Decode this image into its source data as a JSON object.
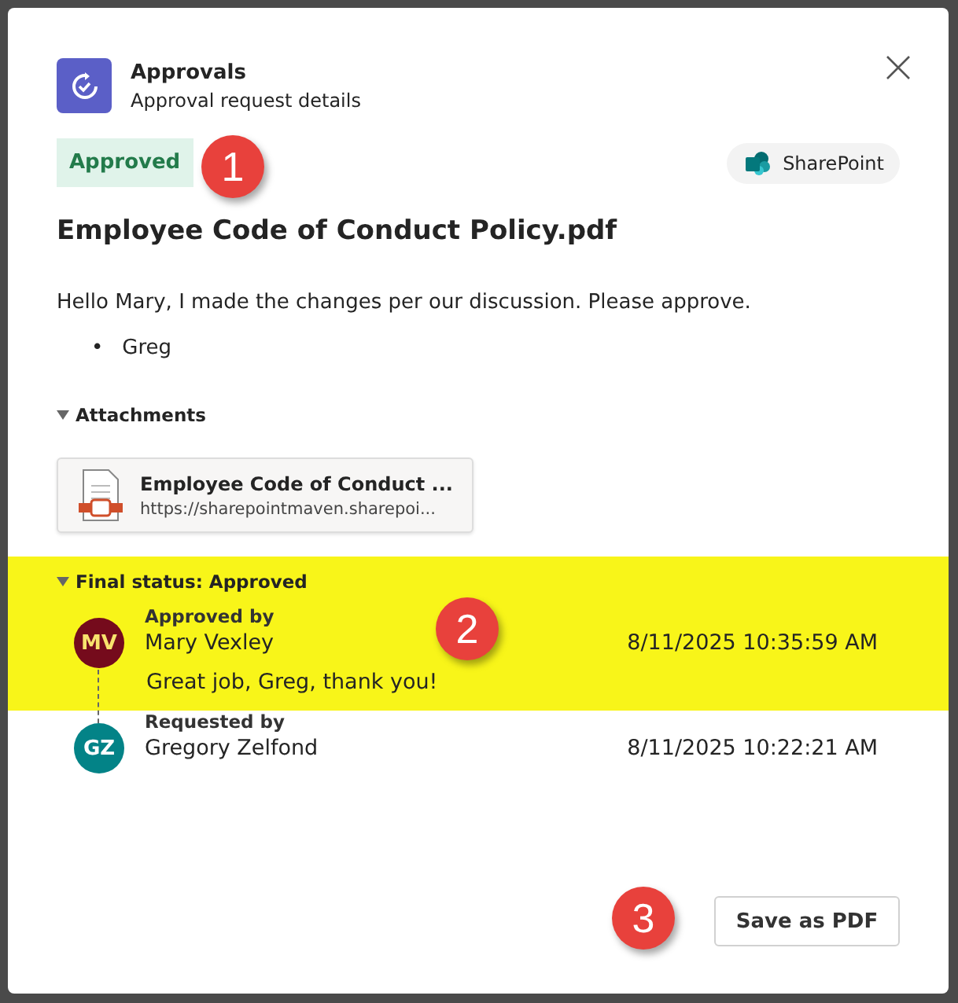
{
  "header": {
    "app_name": "Approvals",
    "subtitle": "Approval request details"
  },
  "status_badge": {
    "label": "Approved",
    "callout": "1"
  },
  "source": {
    "label": "SharePoint"
  },
  "title": "Employee Code of Conduct Policy.pdf",
  "message": "Hello Mary, I made the changes per our discussion. Please approve.",
  "bullets": [
    {
      "marker": "•",
      "text": "Greg"
    }
  ],
  "attachments": {
    "heading": "Attachments",
    "expanded": true,
    "items": [
      {
        "name": "Employee Code of Conduct ...",
        "url": "https://sharepointmaven.sharepoi..."
      }
    ]
  },
  "final_status": {
    "heading": "Final status: Approved",
    "expanded": true,
    "highlighted": true,
    "callout": "2",
    "entries": [
      {
        "initials": "MV",
        "color": "#750b1c",
        "role": "Approved by",
        "name": "Mary Vexley",
        "time": "8/11/2025 10:35:59 AM",
        "comment": "Great job, Greg, thank you!"
      },
      {
        "initials": "GZ",
        "color": "#038387",
        "role": "Requested by",
        "name": "Gregory Zelfond",
        "time": "8/11/2025 10:22:21 AM"
      }
    ]
  },
  "save_button": {
    "label": "Save as PDF",
    "callout": "3"
  }
}
